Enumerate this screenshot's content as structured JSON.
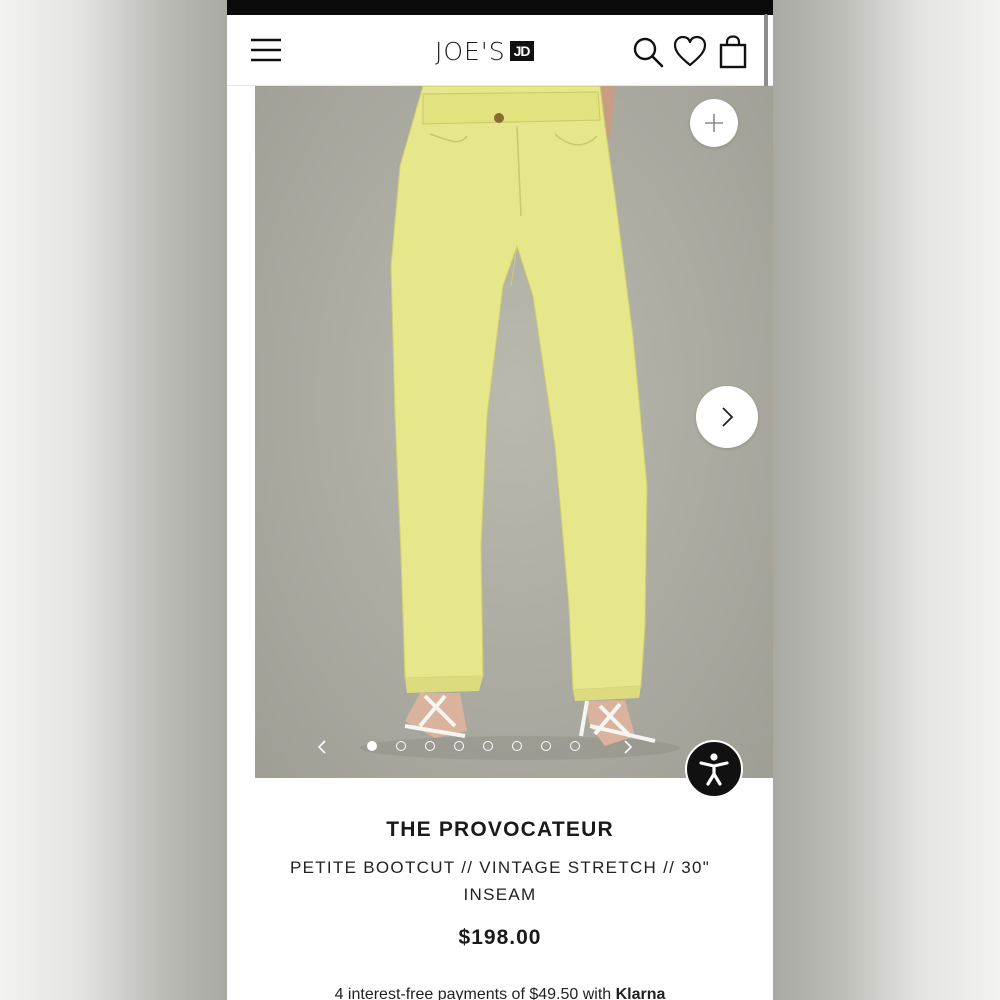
{
  "header": {
    "brand": "JOE'S",
    "brand_mark": "JD",
    "icons": [
      "menu-icon",
      "search-icon",
      "heart-icon",
      "shopping-bag-icon"
    ]
  },
  "gallery": {
    "image_count": 8,
    "active_index": 0,
    "prev_symbol": "‹",
    "next_symbol": "›",
    "zoom_symbol": "+"
  },
  "product": {
    "title": "THE PROVOCATEUR",
    "subtitle": "PETITE BOOTCUT // VINTAGE STRETCH // 30\" INSEAM",
    "price": "$198.00",
    "installments": "4 interest-free payments of $49.50 with",
    "installments_provider": "Klarna"
  },
  "colors": {
    "pants": "#e6e68a",
    "background": "#aaa9a0",
    "text": "#1a1a1a"
  }
}
